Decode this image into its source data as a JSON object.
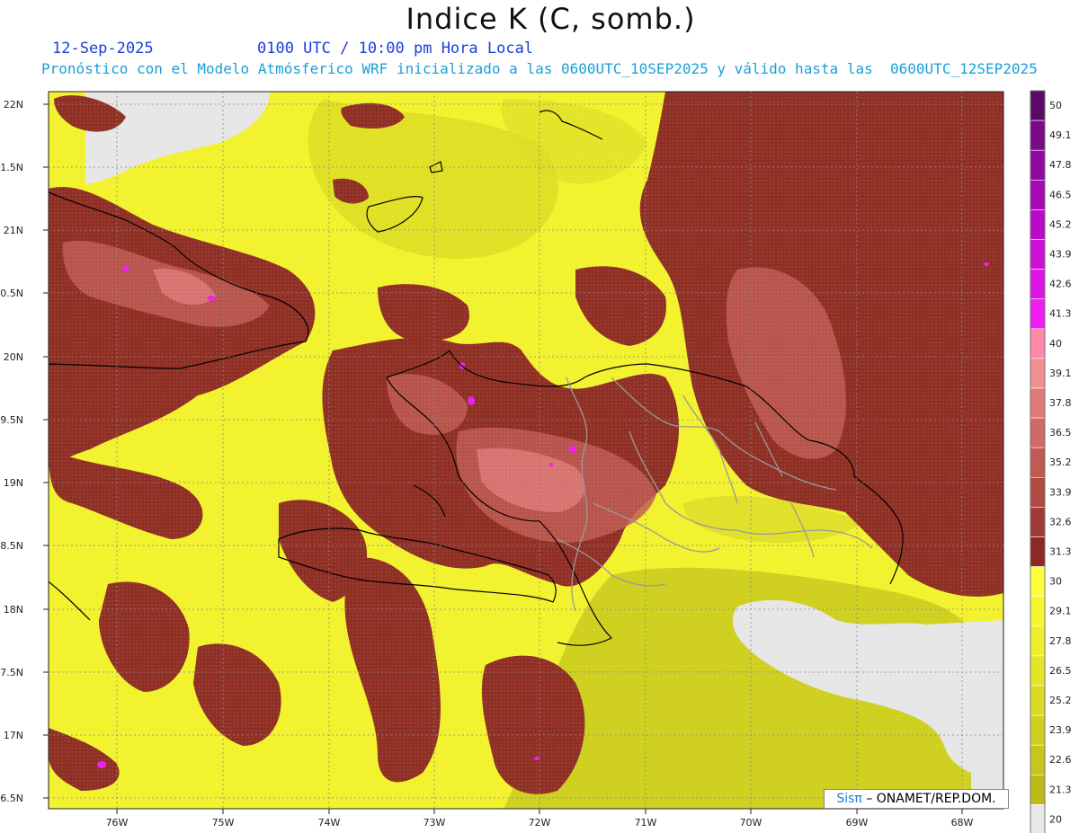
{
  "title": "Indice K (C, somb.)",
  "date": "12-Sep-2025",
  "time": "0100 UTC / 10:00 pm Hora Local",
  "forecast": "Pronóstico con el Modelo Atmósferico WRF inicializado a las 0600UTC_10SEP2025 y válido hasta las  0600UTC_12SEP2025",
  "credit_logo": "Sisπ",
  "credit_text": " – ONAMET/REP.DOM.",
  "lat_labels": [
    "22N",
    "1.5N",
    "21N",
    "0.5N",
    "20N",
    "9.5N",
    "19N",
    "8.5N",
    "18N",
    "7.5N",
    "17N",
    "6.5N"
  ],
  "lon_labels": [
    "76W",
    "75W",
    "74W",
    "73W",
    "72W",
    "71W",
    "70W",
    "69W",
    "68W"
  ],
  "colorbar": {
    "labels": [
      "50",
      "49.1",
      "47.8",
      "46.5",
      "45.2",
      "43.9",
      "42.6",
      "41.3",
      "40",
      "39.1",
      "37.8",
      "36.5",
      "35.2",
      "33.9",
      "32.6",
      "31.3",
      "30",
      "29.1",
      "27.8",
      "26.5",
      "25.2",
      "23.9",
      "22.6",
      "21.3",
      "20"
    ],
    "colors": [
      "#5a0a66",
      "#7a0a88",
      "#8f0aa0",
      "#a50ab4",
      "#b80ac8",
      "#cc10d8",
      "#de14e6",
      "#ee1ef0",
      "#ff88aa",
      "#f09090",
      "#e07a78",
      "#d06a64",
      "#c05a52",
      "#b04a42",
      "#a03a34",
      "#8a2a22",
      "#ffff3c",
      "#f6f630",
      "#eeee2c",
      "#e4e428",
      "#dada24",
      "#d0d020",
      "#c6c61c",
      "#bcbc18",
      "#e8e8e8"
    ]
  }
}
